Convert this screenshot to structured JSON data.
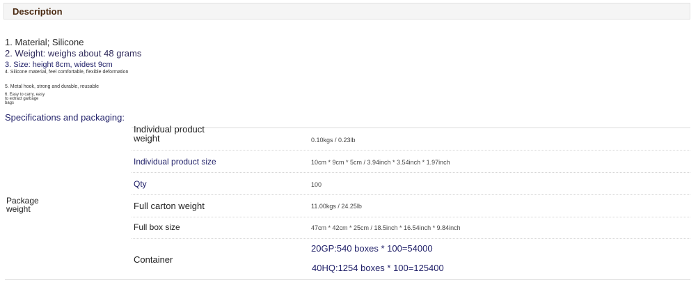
{
  "header": {
    "title": "Description"
  },
  "list": {
    "item1": "1. Material; Silicone",
    "item2": "2. Weight: weighs about 48 grams",
    "item3": "3. Size: height 8cm, widest 9cm",
    "item4": "4. Silicone material, feel comfortable, flexible deformation",
    "item5": "5. Metal hook, strong and durable, reusable",
    "item6": "6. Easy to carry, easy to extract garbage bags"
  },
  "specs": {
    "title": "Specifications and packaging:",
    "group_label": "Package weight",
    "rows": [
      {
        "label": "Individual product weight",
        "value": "0.10kgs / 0.23lb"
      },
      {
        "label": "Individual product size",
        "value": "10cm * 9cm * 5cm / 3.94inch * 3.54inch * 1.97inch"
      },
      {
        "label": "Qty",
        "value": "100"
      },
      {
        "label": "Full carton weight",
        "value": "11.00kgs / 24.25lb"
      },
      {
        "label": "Full box size",
        "value": "47cm * 42cm * 25cm / 18.5inch * 16.54inch * 9.84inch"
      }
    ],
    "container": {
      "label": "Container",
      "values": [
        "20GP:540 boxes * 100=54000",
        "40HQ:1254 boxes * 100=125400"
      ]
    }
  }
}
